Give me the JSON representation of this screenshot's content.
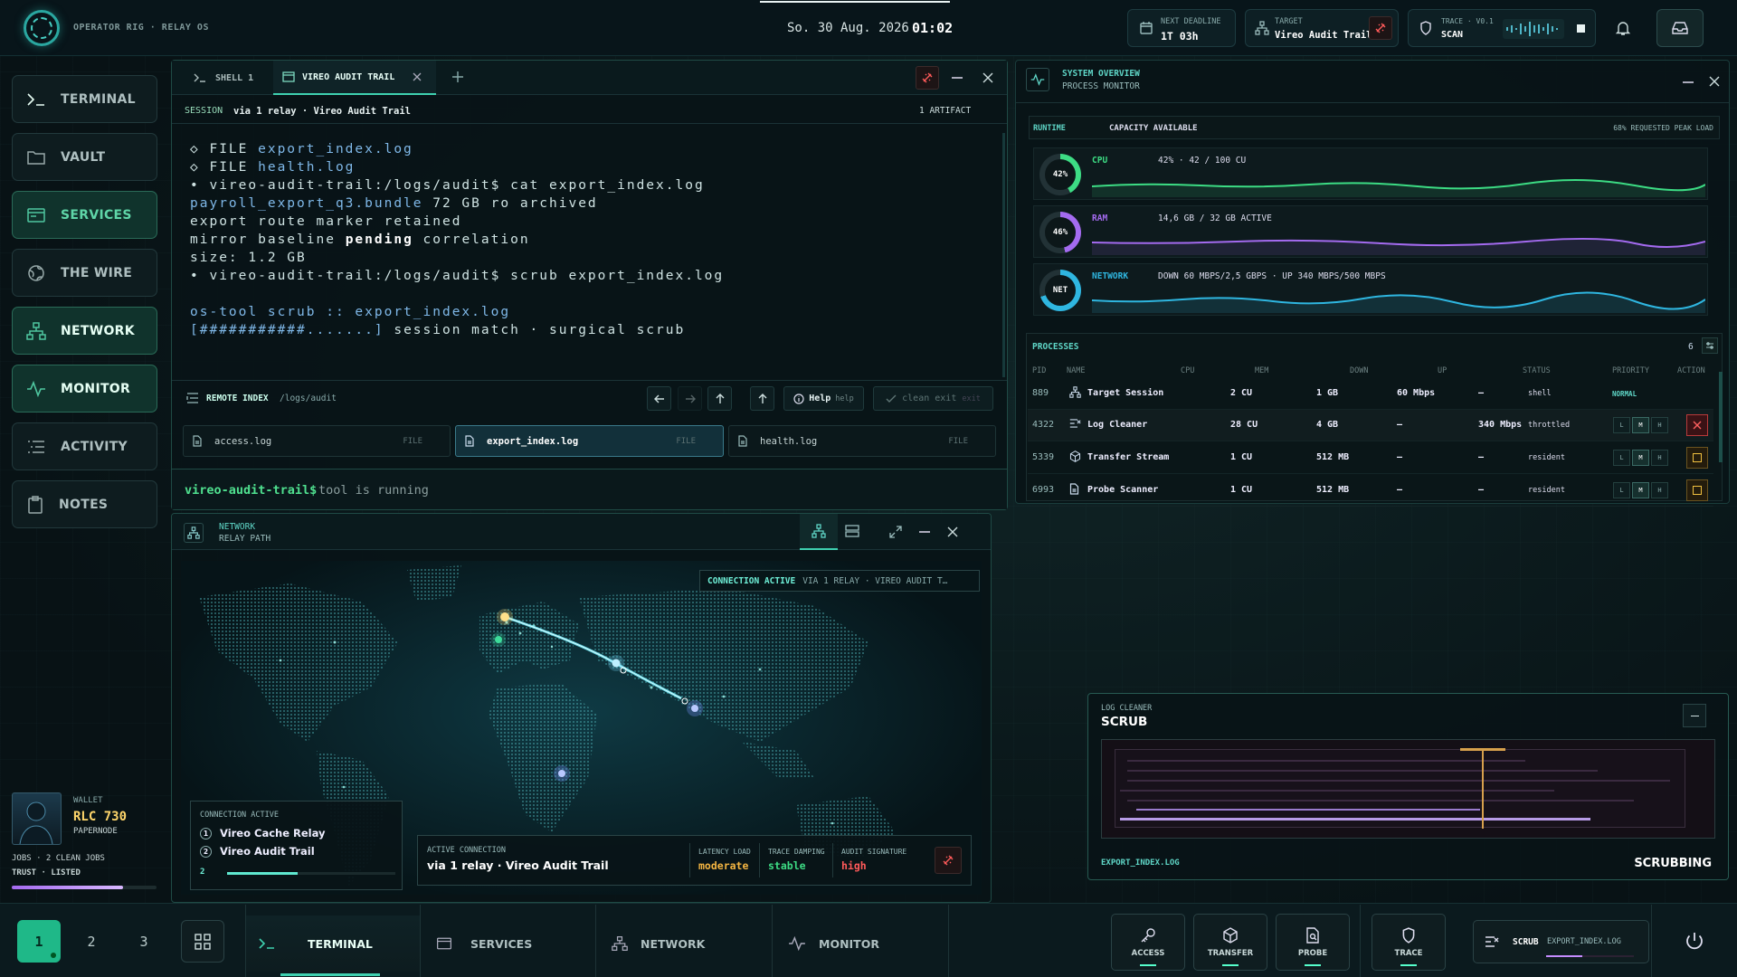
{
  "app": {
    "name": "OPERATOR RIG · RELAY OS",
    "date": "So. 30 Aug. 2026",
    "time": "01:02"
  },
  "top": {
    "deadline": {
      "label": "NEXT DEADLINE",
      "value": "1T 03h"
    },
    "target": {
      "label": "TARGET",
      "value": "Vireo Audit Trail"
    },
    "trace": {
      "label": "TRACE · V0.1",
      "value": "SCAN"
    }
  },
  "nav": [
    {
      "label": "TERMINAL",
      "icon": "terminal-icon",
      "state": "active"
    },
    {
      "label": "VAULT",
      "icon": "folder-icon",
      "state": ""
    },
    {
      "label": "SERVICES",
      "icon": "window-icon",
      "state": "sel"
    },
    {
      "label": "THE WIRE",
      "icon": "globe-icon",
      "state": ""
    },
    {
      "label": "NETWORK",
      "icon": "network-icon",
      "state": "sel"
    },
    {
      "label": "MONITOR",
      "icon": "pulse-icon",
      "state": "sel"
    },
    {
      "label": "ACTIVITY",
      "icon": "list-icon",
      "state": ""
    },
    {
      "label": "NOTES",
      "icon": "clipboard-icon",
      "state": ""
    }
  ],
  "wallet": {
    "label": "WALLET",
    "amount": "RLC 730",
    "node": "PAPERNODE",
    "jobs": "JOBS · 2 CLEAN JOBS",
    "trust": "TRUST · LISTED",
    "trust_level": 0.77
  },
  "terminal": {
    "tabs": [
      "SHELL 1",
      "VIREO AUDIT TRAIL"
    ],
    "session_label": "SESSION",
    "session_value": "via 1 relay · Vireo Audit Trail",
    "artifacts": "1 ARTIFACT",
    "lines": {
      "l1a": "◇ FILE ",
      "l1b": "export_index.log",
      "l2a": "◇ FILE ",
      "l2b": "health.log",
      "l3": "• vireo-audit-trail:/logs/audit$ cat export_index.log",
      "l4a": "payroll_export_q3.bundle",
      "l4b": " 72 GB ro archived",
      "l5": "export route marker retained",
      "l6a": "mirror baseline ",
      "l6b": "pending",
      "l6c": " correlation",
      "l7": "size: 1.2 GB",
      "l8": "• vireo-audit-trail:/logs/audit$ scrub export_index.log",
      "l9": "os-tool scrub :: export_index.log",
      "l10a": "[###########.......]",
      "l10b": " session match · surgical scrub"
    },
    "remote_label": "REMOTE INDEX",
    "remote_path": "/logs/audit",
    "help": "Help",
    "help_hint": "help",
    "clean_exit": "clean exit",
    "clean_hint": "exit",
    "files": [
      {
        "name": "access.log",
        "tag": "FILE"
      },
      {
        "name": "export_index.log",
        "tag": "FILE"
      },
      {
        "name": "health.log",
        "tag": "FILE"
      }
    ],
    "prompt": "vireo-audit-trail$",
    "prompt_status": "tool is running"
  },
  "network": {
    "title": "NETWORK",
    "subtitle": "RELAY PATH",
    "status": "CONNECTION ACTIVE",
    "status_detail": "VIA 1 RELAY · VIREO AUDIT T…",
    "conn_label": "CONNECTION ACTIVE",
    "hops": [
      {
        "n": "1",
        "name": "Vireo Cache Relay"
      },
      {
        "n": "2",
        "name": "Vireo Audit Trail"
      }
    ],
    "hop_count": "2",
    "active_label": "ACTIVE CONNECTION",
    "active_value": "via 1 relay · Vireo Audit Trail",
    "latency_label": "LATENCY LOAD",
    "latency": "moderate",
    "damping_label": "TRACE DAMPING",
    "damping": "stable",
    "signature_label": "AUDIT SIGNATURE",
    "signature": "high"
  },
  "system": {
    "title": "SYSTEM OVERVIEW",
    "subtitle": "PROCESS MONITOR",
    "runtime": "RUNTIME",
    "capacity": "CAPACITY AVAILABLE",
    "peak": "68% REQUESTED PEAK LOAD",
    "metrics": [
      {
        "gauge": "42%",
        "name": "CPU",
        "value": "42% · 42 / 100 CU",
        "color": "#3ddc84",
        "level": 0.42
      },
      {
        "gauge": "46%",
        "name": "RAM",
        "value": "14,6 GB / 32 GB ACTIVE",
        "color": "#a46bf0",
        "level": 0.46
      },
      {
        "gauge": "NET",
        "name": "NETWORK",
        "value": "DOWN 60 MBPS/2,5 GBPS · UP 340 MBPS/500 MBPS",
        "color": "#2fb6e0",
        "level": 0.7
      }
    ],
    "processes_label": "PROCESSES",
    "process_count": "6",
    "columns": [
      "PID",
      "NAME",
      "CPU",
      "MEM",
      "DOWN",
      "UP",
      "STATUS",
      "PRIORITY",
      "ACTION"
    ],
    "processes": [
      {
        "pid": "889",
        "name": "Target Session",
        "cpu": "2 CU",
        "mem": "1 GB",
        "down": "60 Mbps",
        "up": "—",
        "status": "shell",
        "priority": "NORMAL"
      },
      {
        "pid": "4322",
        "name": "Log Cleaner",
        "cpu": "28 CU",
        "mem": "4 GB",
        "down": "—",
        "up": "340 Mbps",
        "status": "throttled",
        "priority": ""
      },
      {
        "pid": "5339",
        "name": "Transfer Stream",
        "cpu": "1 CU",
        "mem": "512 MB",
        "down": "—",
        "up": "—",
        "status": "resident",
        "priority": ""
      },
      {
        "pid": "6993",
        "name": "Probe Scanner",
        "cpu": "1 CU",
        "mem": "512 MB",
        "down": "—",
        "up": "—",
        "status": "resident",
        "priority": ""
      }
    ],
    "lvl": [
      "L",
      "M",
      "H"
    ]
  },
  "scrub": {
    "label": "LOG CLEANER",
    "title": "SCRUB",
    "file": "EXPORT_INDEX.LOG",
    "status": "SCRUBBING"
  },
  "taskbar": {
    "workspaces": [
      "1",
      "2",
      "3"
    ],
    "apps": [
      {
        "label": "TERMINAL",
        "icon": "terminal-icon"
      },
      {
        "label": "SERVICES",
        "icon": "window-icon"
      },
      {
        "label": "NETWORK",
        "icon": "network-icon"
      },
      {
        "label": "MONITOR",
        "icon": "pulse-icon"
      }
    ],
    "actions": [
      "ACCESS",
      "TRANSFER",
      "PROBE",
      "TRACE"
    ],
    "scrub_label": "SCRUB",
    "scrub_file": "EXPORT_INDEX.LOG"
  }
}
